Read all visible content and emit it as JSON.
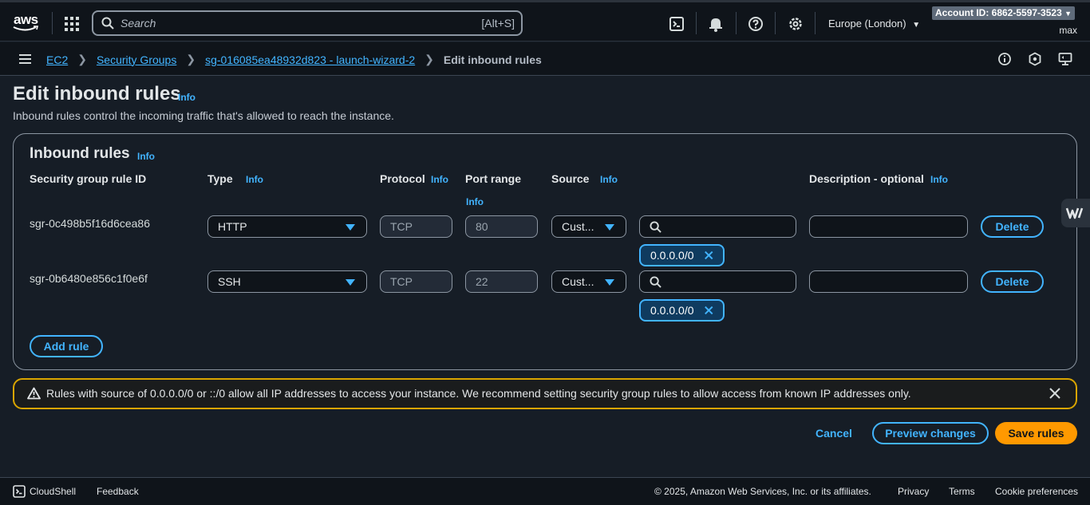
{
  "topnav": {
    "logo_text": "aws",
    "search_placeholder": "Search",
    "search_shortcut": "[Alt+S]",
    "region": "Europe (London)",
    "account_label": "Account ID: 6862-5597-3523",
    "user": "max"
  },
  "breadcrumb": {
    "items": [
      "EC2",
      "Security Groups",
      "sg-016085ea48932d823 - launch-wizard-2"
    ],
    "current": "Edit inbound rules"
  },
  "page": {
    "title": "Edit inbound rules",
    "title_info": "Info",
    "description": "Inbound rules control the incoming traffic that's allowed to reach the instance."
  },
  "rules_panel": {
    "title": "Inbound rules",
    "title_info": "Info",
    "columns": {
      "rule_id": "Security group rule ID",
      "type": "Type",
      "protocol": "Protocol",
      "port_range": "Port range",
      "source": "Source",
      "description": "Description - optional"
    },
    "info_label": "Info",
    "rules": [
      {
        "id": "sgr-0c498b5f16d6cea86",
        "type": "HTTP",
        "protocol": "TCP",
        "port": "80",
        "source_type": "Cust...",
        "source_search": "",
        "cidr": "0.0.0.0/0",
        "description": "",
        "delete_label": "Delete"
      },
      {
        "id": "sgr-0b6480e856c1f0e6f",
        "type": "SSH",
        "protocol": "TCP",
        "port": "22",
        "source_type": "Cust...",
        "source_search": "",
        "cidr": "0.0.0.0/0",
        "description": "",
        "delete_label": "Delete"
      }
    ],
    "add_rule_label": "Add rule"
  },
  "warning": {
    "text": "Rules with source of 0.0.0.0/0 or ::/0 allow all IP addresses to access your instance. We recommend setting security group rules to allow access from known IP addresses only."
  },
  "actions": {
    "cancel": "Cancel",
    "preview": "Preview changes",
    "save": "Save rules"
  },
  "footer": {
    "cloudshell": "CloudShell",
    "feedback": "Feedback",
    "copyright": "© 2025, Amazon Web Services, Inc. or its affiliates.",
    "privacy": "Privacy",
    "terms": "Terms",
    "cookies": "Cookie preferences"
  },
  "colors": {
    "accent": "#42b4ff",
    "primary_button": "#ff9900",
    "warning_border": "#d9a500",
    "background": "#161d26"
  },
  "icons": [
    "search-icon",
    "apps-grid-icon",
    "cloudshell-icon",
    "bell-icon",
    "help-icon",
    "settings-icon",
    "menu-icon",
    "info-circle-icon",
    "notifications-hex-icon",
    "monitor-icon",
    "close-icon",
    "warning-icon",
    "caret-down-icon"
  ]
}
